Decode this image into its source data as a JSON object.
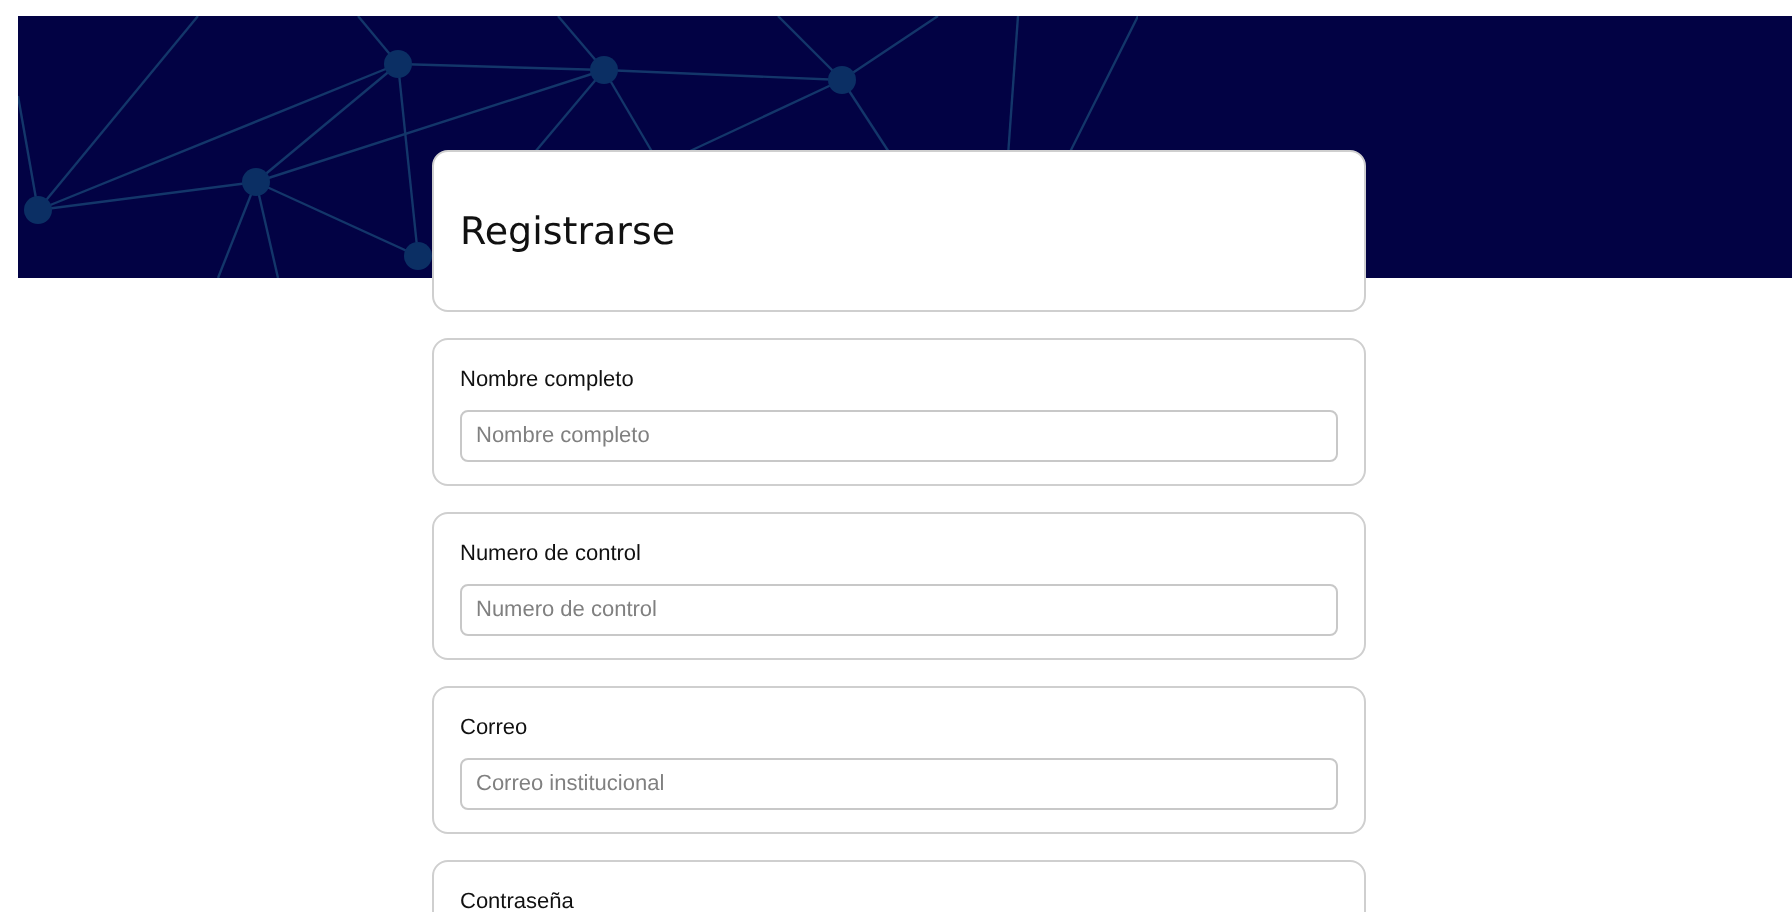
{
  "title": "Registrarse",
  "fields": [
    {
      "label": "Nombre completo",
      "placeholder": "Nombre completo"
    },
    {
      "label": "Numero de control",
      "placeholder": "Numero de control"
    },
    {
      "label": "Correo",
      "placeholder": "Correo institucional"
    },
    {
      "label": "Contraseña"
    }
  ]
}
